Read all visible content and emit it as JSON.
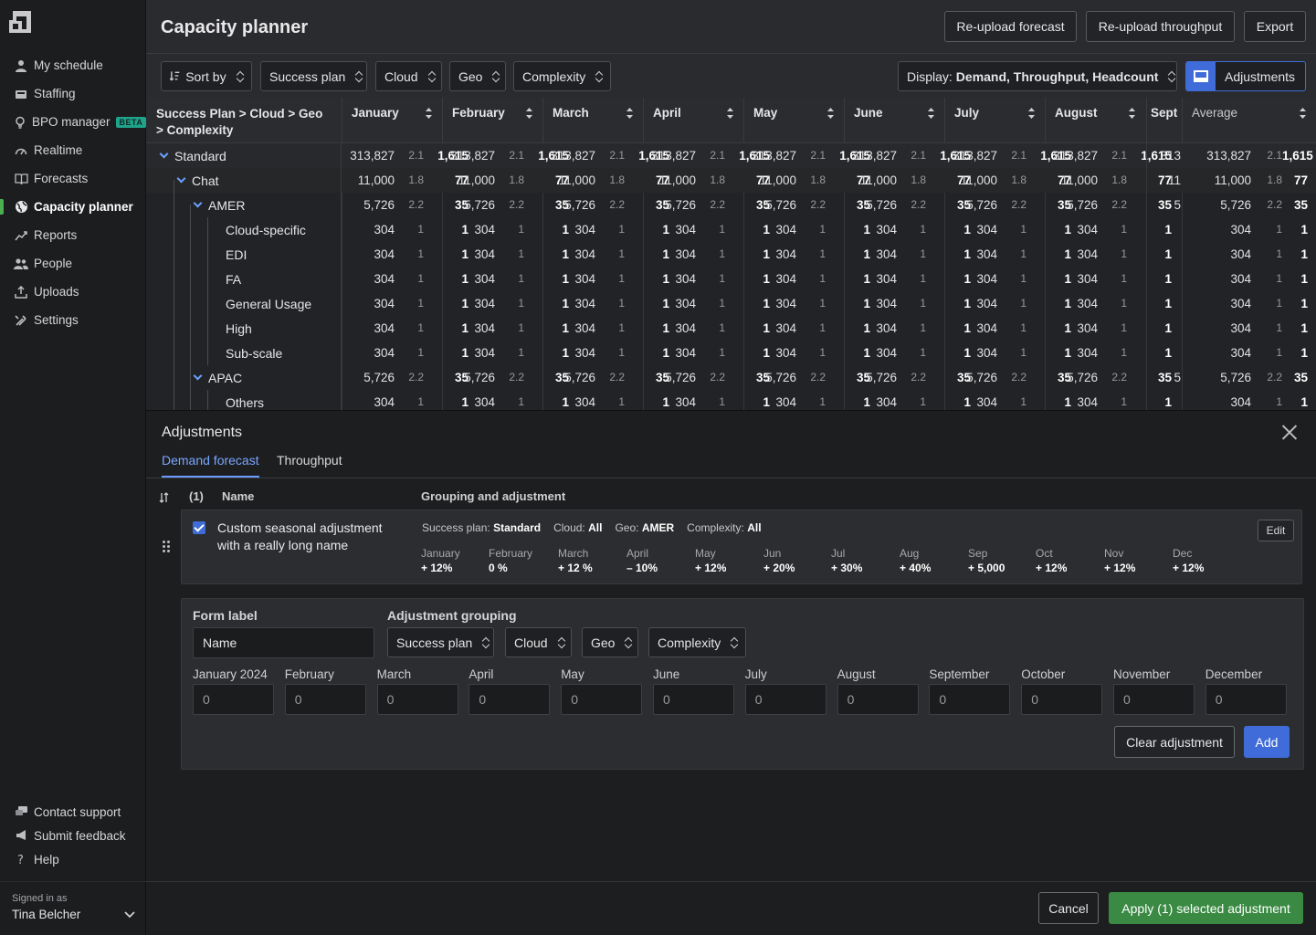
{
  "app": {
    "title": "Capacity planner"
  },
  "header_buttons": {
    "reupload_forecast": "Re-upload forecast",
    "reupload_throughput": "Re-upload throughput",
    "export": "Export"
  },
  "sidebar": {
    "items": [
      {
        "label": "My schedule",
        "icon": "person-icon"
      },
      {
        "label": "Staffing",
        "icon": "inbox-icon"
      },
      {
        "label": "BPO manager",
        "icon": "lightbulb-icon",
        "badge": "BETA"
      },
      {
        "label": "Realtime",
        "icon": "gauge-icon"
      },
      {
        "label": "Forecasts",
        "icon": "book-icon"
      },
      {
        "label": "Capacity planner",
        "icon": "globe-icon",
        "active": true
      },
      {
        "label": "Reports",
        "icon": "trend-icon"
      },
      {
        "label": "People",
        "icon": "people-icon"
      },
      {
        "label": "Uploads",
        "icon": "upload-icon"
      },
      {
        "label": "Settings",
        "icon": "tools-icon"
      }
    ],
    "bottom": [
      {
        "label": "Contact support",
        "icon": "chat-icon"
      },
      {
        "label": "Submit feedback",
        "icon": "megaphone-icon"
      },
      {
        "label": "Help",
        "icon": "question-icon"
      }
    ],
    "signed_in_label": "Signed in as",
    "user": "Tina Belcher"
  },
  "filters": {
    "sort_by": "Sort by",
    "success_plan": "Success plan",
    "cloud": "Cloud",
    "geo": "Geo",
    "complexity": "Complexity",
    "display_label": "Display:",
    "display_value": "Demand, Throughput, Headcount",
    "adjustments": "Adjustments"
  },
  "table": {
    "first_header": "Success Plan > Cloud > Geo > Complexity",
    "columns": [
      "January",
      "February",
      "March",
      "April",
      "May",
      "June",
      "July",
      "August",
      "Sept",
      "Average"
    ],
    "rows": [
      {
        "name": "Standard",
        "level": 0,
        "caret": true,
        "d": "313,827",
        "t": "2.1",
        "h": "1,615",
        "sept": "313"
      },
      {
        "name": "Chat",
        "level": 1,
        "caret": true,
        "d": "11,000",
        "t": "1.8",
        "h": "77",
        "sept": "11"
      },
      {
        "name": "AMER",
        "level": 2,
        "caret": true,
        "d": "5,726",
        "t": "2.2",
        "h": "35",
        "sept": "5"
      },
      {
        "name": "Cloud-specific",
        "level": 3,
        "caret": false,
        "d": "304",
        "t": "1",
        "h": "1",
        "sept": ""
      },
      {
        "name": "EDI",
        "level": 3,
        "caret": false,
        "d": "304",
        "t": "1",
        "h": "1",
        "sept": ""
      },
      {
        "name": "FA",
        "level": 3,
        "caret": false,
        "d": "304",
        "t": "1",
        "h": "1",
        "sept": ""
      },
      {
        "name": "General Usage",
        "level": 3,
        "caret": false,
        "d": "304",
        "t": "1",
        "h": "1",
        "sept": ""
      },
      {
        "name": "High",
        "level": 3,
        "caret": false,
        "d": "304",
        "t": "1",
        "h": "1",
        "sept": ""
      },
      {
        "name": "Sub-scale",
        "level": 3,
        "caret": false,
        "d": "304",
        "t": "1",
        "h": "1",
        "sept": ""
      },
      {
        "name": "APAC",
        "level": 2,
        "caret": true,
        "d": "5,726",
        "t": "2.2",
        "h": "35",
        "sept": "5"
      },
      {
        "name": "Others",
        "level": 3,
        "caret": false,
        "d": "304",
        "t": "1",
        "h": "1",
        "sept": ""
      }
    ]
  },
  "panel": {
    "title": "Adjustments",
    "tabs": [
      "Demand forecast",
      "Throughput"
    ],
    "list_header": {
      "count": "(1)",
      "name": "Name",
      "grouping": "Grouping and adjustment"
    },
    "adjustment": {
      "name": "Custom seasonal adjustment with a really long name",
      "grouping": [
        {
          "k": "Success plan:",
          "v": "Standard"
        },
        {
          "k": "Cloud:",
          "v": "All"
        },
        {
          "k": "Geo:",
          "v": "AMER"
        },
        {
          "k": "Complexity:",
          "v": "All"
        }
      ],
      "months": [
        {
          "m": "January",
          "v": "+ 12%"
        },
        {
          "m": "February",
          "v": "0 %"
        },
        {
          "m": "March",
          "v": "+ 12 %"
        },
        {
          "m": "April",
          "v": "– 10%"
        },
        {
          "m": "May",
          "v": "+ 12%"
        },
        {
          "m": "Jun",
          "v": "+ 20%"
        },
        {
          "m": "Jul",
          "v": "+ 30%"
        },
        {
          "m": "Aug",
          "v": "+ 40%"
        },
        {
          "m": "Sep",
          "v": "+ 5,000"
        },
        {
          "m": "Oct",
          "v": "+ 12%"
        },
        {
          "m": "Nov",
          "v": "+ 12%"
        },
        {
          "m": "Dec",
          "v": "+ 12%"
        }
      ],
      "edit": "Edit"
    },
    "form": {
      "form_label": "Form label",
      "name_value": "Name",
      "grouping_label": "Adjustment grouping",
      "grouping": [
        "Success plan",
        "Cloud",
        "Geo",
        "Complexity"
      ],
      "months": [
        "January 2024",
        "February",
        "March",
        "April",
        "May",
        "June",
        "July",
        "August",
        "September",
        "October",
        "November",
        "December"
      ],
      "month_value": "0",
      "clear": "Clear adjustment",
      "add": "Add"
    }
  },
  "footer": {
    "cancel": "Cancel",
    "apply": "Apply (1) selected adjustment"
  },
  "colors": {
    "accent": "#3f6cd8",
    "apply": "#3a8a43",
    "active_marker": "#4caf50"
  }
}
